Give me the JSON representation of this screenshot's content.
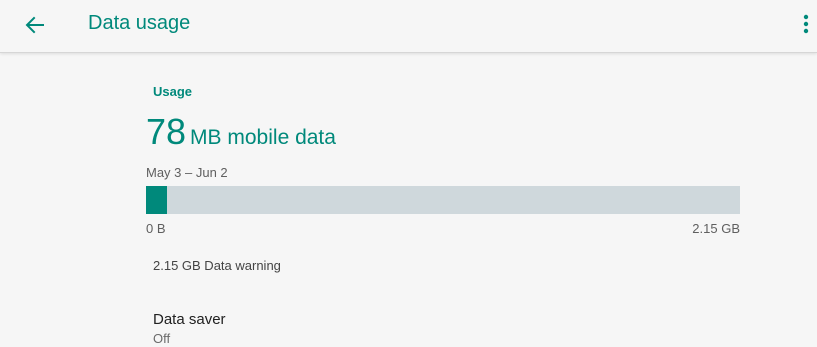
{
  "toolbar": {
    "title": "Data usage",
    "back_icon": "arrow-back-icon",
    "more_icon": "more-vert-icon"
  },
  "usage": {
    "section_title": "Usage",
    "amount": "78",
    "unit_label": "MB mobile data",
    "date_range": "May 3 – Jun 2",
    "bar": {
      "min_label": "0 B",
      "max_label": "2.15 GB",
      "fill_fraction": 0.036
    },
    "warning": "2.15 GB Data warning"
  },
  "data_saver": {
    "title": "Data saver",
    "summary": "Off"
  },
  "colors": {
    "accent": "#00897b",
    "bar_track": "#cfd8dc",
    "background": "#f6f6f6"
  }
}
